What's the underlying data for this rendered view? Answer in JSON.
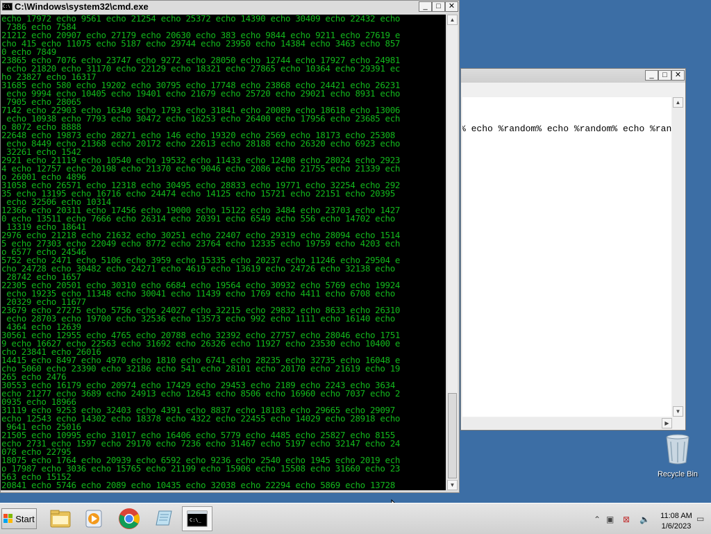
{
  "cmd_window": {
    "title": "C:\\Windows\\system32\\cmd.exe",
    "minimize": "_",
    "maximize": "□",
    "close": "✕",
    "lines": [
      "echo 17972 echo 9561 echo 21254 echo 25372 echo 14390 echo 30409 echo 22432 echo",
      " 7386 echo 7584",
      "21212 echo 20907 echo 27179 echo 20630 echo 383 echo 9844 echo 9211 echo 27619 e",
      "cho 415 echo 11075 echo 5187 echo 29744 echo 23950 echo 14384 echo 3463 echo 857",
      "0 echo 7849",
      "23865 echo 7076 echo 23747 echo 9272 echo 28050 echo 12744 echo 17927 echo 24981",
      " echo 21820 echo 31170 echo 22129 echo 18321 echo 27865 echo 10364 echo 29391 ec",
      "ho 23827 echo 16317",
      "31685 echo 580 echo 19202 echo 30795 echo 17748 echo 23868 echo 24421 echo 26231",
      " echo 9994 echo 10405 echo 19401 echo 21679 echo 25720 echo 29021 echo 8931 echo",
      " 7905 echo 28065",
      "7142 echo 22903 echo 16340 echo 1793 echo 31841 echo 20089 echo 18618 echo 13006",
      " echo 10938 echo 7793 echo 30472 echo 16253 echo 26400 echo 17956 echo 23685 ech",
      "o 8072 echo 8888",
      "22648 echo 19873 echo 28271 echo 146 echo 19320 echo 2569 echo 18173 echo 25308",
      " echo 8449 echo 21368 echo 20172 echo 22613 echo 28188 echo 26320 echo 6923 echo",
      " 32261 echo 1542",
      "2921 echo 21119 echo 10540 echo 19532 echo 11433 echo 12408 echo 28024 echo 2923",
      "4 echo 12757 echo 20198 echo 21370 echo 9046 echo 2086 echo 21755 echo 21339 ech",
      "o 26001 echo 4896",
      "31058 echo 26571 echo 12318 echo 30495 echo 28833 echo 19771 echo 32254 echo 292",
      "35 echo 13195 echo 16716 echo 24474 echo 14125 echo 15721 echo 22151 echo 20395",
      " echo 32506 echo 10314",
      "12366 echo 20311 echo 17456 echo 19000 echo 15122 echo 3484 echo 23703 echo 1427",
      "0 echo 13511 echo 7666 echo 26314 echo 20391 echo 6549 echo 556 echo 14702 echo",
      " 13319 echo 18641",
      "2976 echo 21218 echo 21632 echo 30251 echo 22407 echo 29319 echo 28094 echo 1514",
      "5 echo 27303 echo 22049 echo 8772 echo 23764 echo 12335 echo 19759 echo 4203 ech",
      "o 6577 echo 24546",
      "5752 echo 2471 echo 5106 echo 3959 echo 15335 echo 20237 echo 11246 echo 29504 e",
      "cho 24728 echo 30482 echo 24271 echo 4619 echo 13619 echo 24726 echo 32138 echo",
      " 28742 echo 1657",
      "22305 echo 20501 echo 30310 echo 6684 echo 19564 echo 30932 echo 5769 echo 19924",
      " echo 19235 echo 11348 echo 30041 echo 11439 echo 1769 echo 4411 echo 6708 echo",
      " 20329 echo 11677",
      "23679 echo 27275 echo 5756 echo 24027 echo 32215 echo 29832 echo 8633 echo 26310",
      " echo 28703 echo 19700 echo 32536 echo 13573 echo 992 echo 1111 echo 16140 echo",
      " 4364 echo 12639",
      "30561 echo 12955 echo 4765 echo 20788 echo 32392 echo 27757 echo 28046 echo 1751",
      "9 echo 16627 echo 22563 echo 31692 echo 26326 echo 11927 echo 23530 echo 10400 e",
      "cho 23841 echo 26016",
      "14415 echo 8497 echo 4970 echo 1810 echo 6741 echo 28235 echo 32735 echo 16048 e",
      "cho 5060 echo 23390 echo 32186 echo 541 echo 28101 echo 20170 echo 21619 echo 19",
      "265 echo 2476",
      "30553 echo 16179 echo 20974 echo 17429 echo 29453 echo 2189 echo 2243 echo 3634",
      "echo 21277 echo 3689 echo 24913 echo 12643 echo 8506 echo 16960 echo 7037 echo 2",
      "0935 echo 18966",
      "31119 echo 9253 echo 32403 echo 4391 echo 8837 echo 18183 echo 29665 echo 29097",
      "echo 12543 echo 14302 echo 18378 echo 4322 echo 22455 echo 14029 echo 28918 echo",
      " 9641 echo 25016",
      "21505 echo 10995 echo 31017 echo 16406 echo 5779 echo 4485 echo 25827 echo 8155",
      "echo 2731 echo 1597 echo 29170 echo 7236 echo 31467 echo 5197 echo 32147 echo 24",
      "078 echo 22795",
      "18075 echo 1764 echo 20939 echo 6592 echo 9236 echo 2540 echo 1945 echo 2019 ech",
      "o 17987 echo 3036 echo 15765 echo 21199 echo 15906 echo 15508 echo 31660 echo 23",
      "563 echo 15152",
      "20841 echo 5746 echo 2089 echo 10435 echo 32038 echo 22294 echo 5869 echo 13728"
    ]
  },
  "notepad_window": {
    "minimize": "_",
    "maximize": "□",
    "close": "✕",
    "content": "% echo %random% echo %random% echo %random% echo %ran"
  },
  "desktop": {
    "recycle_bin_label": "Recycle Bin"
  },
  "taskbar": {
    "start_label": "Start",
    "time": "11:08 AM",
    "date": "1/6/2023"
  },
  "icons": {
    "start": "windows-logo-icon",
    "explorer": "folder-icon",
    "media": "media-player-icon",
    "chrome": "chrome-icon",
    "notepad": "notepad-icon",
    "cmd": "cmd-icon"
  }
}
